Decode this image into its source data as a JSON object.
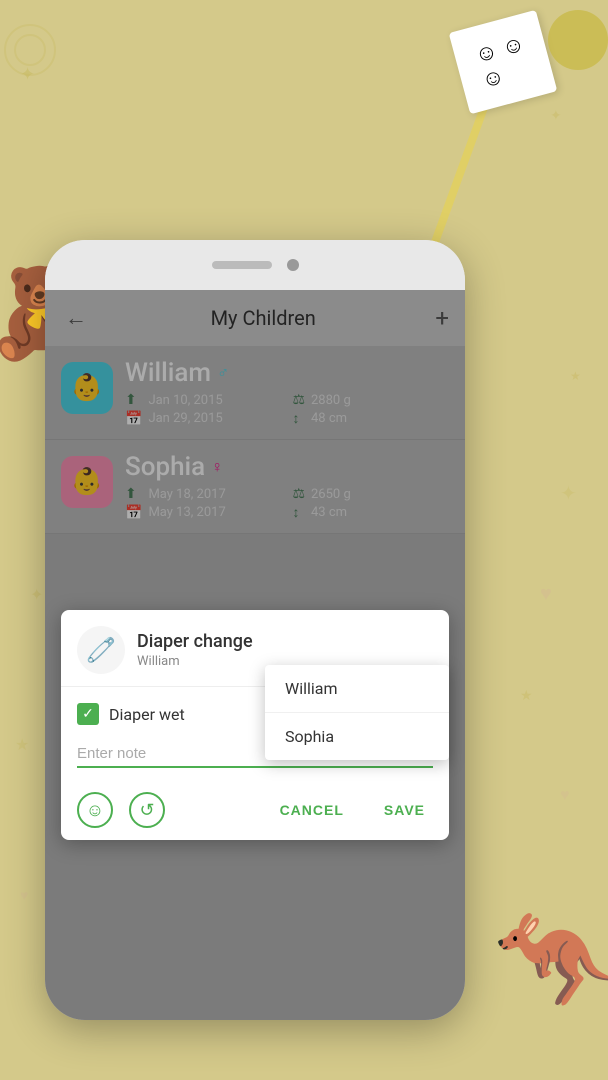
{
  "background": {
    "color": "#d4c98a"
  },
  "header": {
    "back_icon": "←",
    "title": "My Children",
    "add_icon": "+"
  },
  "children": [
    {
      "name": "William",
      "gender": "boy",
      "gender_symbol": "♂",
      "birth_date": "Jan 10, 2015",
      "first_date": "Jan 29, 2015",
      "weight": "2880 g",
      "height": "48 cm",
      "avatar_emoji": "👶"
    },
    {
      "name": "Sophia",
      "gender": "girl",
      "gender_symbol": "♀",
      "birth_date": "May 18, 2017",
      "first_date": "May 13, 2017",
      "weight": "2650 g",
      "height": "43 cm",
      "avatar_emoji": "👶"
    }
  ],
  "dialog": {
    "title": "Diaper change",
    "child_name": "William",
    "icon": "🧷",
    "checkbox_label": "Diaper wet",
    "checked": true,
    "note_placeholder": "Enter note",
    "cancel_label": "CANCEL",
    "save_label": "SAVE"
  },
  "dropdown": {
    "options": [
      "William",
      "Sophia"
    ]
  },
  "decorations": {
    "note_faces": "☺ ☺ ☺"
  }
}
